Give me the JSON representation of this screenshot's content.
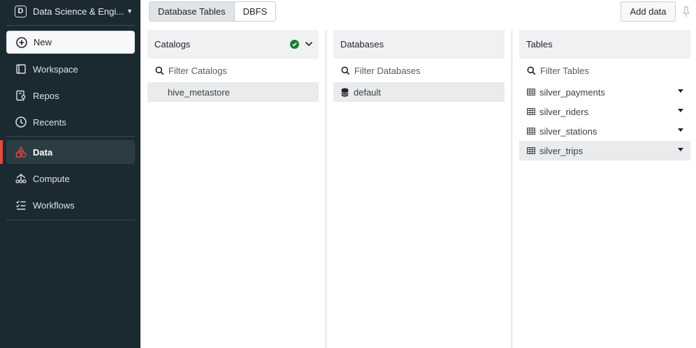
{
  "sidebar": {
    "workspace_initial": "D",
    "workspace_name": "Data Science & Engi...",
    "new_label": "New",
    "items": [
      {
        "label": "Workspace",
        "icon": "workspace-icon"
      },
      {
        "label": "Repos",
        "icon": "repos-icon"
      },
      {
        "label": "Recents",
        "icon": "clock-icon"
      },
      {
        "label": "Data",
        "icon": "data-icon",
        "active": true
      },
      {
        "label": "Compute",
        "icon": "compute-icon"
      },
      {
        "label": "Workflows",
        "icon": "workflows-icon"
      }
    ],
    "accent": "#e2483d"
  },
  "toolbar": {
    "tabs": [
      "Database Tables",
      "DBFS"
    ],
    "active_tab": "Database Tables",
    "add_data_label": "Add data"
  },
  "catalogs": {
    "header": "Catalogs",
    "filter_placeholder": "Filter Catalogs",
    "items": [
      "hive_metastore"
    ]
  },
  "databases": {
    "header": "Databases",
    "filter_placeholder": "Filter Databases",
    "items": [
      "default"
    ]
  },
  "tables": {
    "header": "Tables",
    "filter_placeholder": "Filter Tables",
    "items": [
      "silver_payments",
      "silver_riders",
      "silver_stations",
      "silver_trips"
    ],
    "selected": "silver_trips"
  }
}
